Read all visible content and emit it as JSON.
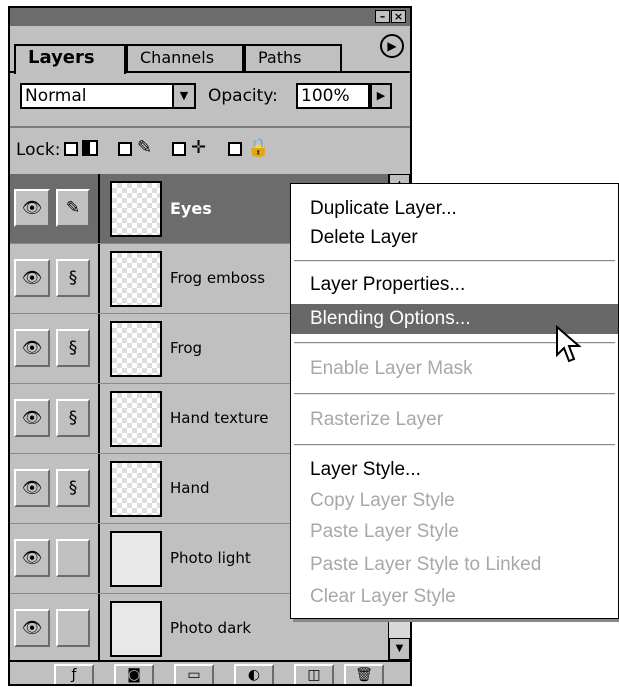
{
  "panel": {
    "window_buttons": {
      "minimize": "–",
      "close": "×"
    },
    "tabs": [
      {
        "label": "Layers"
      },
      {
        "label": "Channels"
      },
      {
        "label": "Paths"
      }
    ],
    "menu_arrow": "▶"
  },
  "blend": {
    "mode": "Normal",
    "opacity_label": "Opacity:",
    "opacity_value": "100%"
  },
  "lock": {
    "label": "Lock:",
    "icons": [
      "transparency-lock-icon",
      "brush-icon",
      "move-icon",
      "padlock-icon"
    ]
  },
  "layers": [
    {
      "name": "Eyes",
      "selected": true,
      "link_icon": "brush-icon"
    },
    {
      "name": "Frog emboss",
      "selected": false,
      "link_icon": "chain-link-icon"
    },
    {
      "name": "Frog",
      "selected": false,
      "link_icon": "chain-link-icon"
    },
    {
      "name": "Hand texture",
      "selected": false,
      "link_icon": "chain-link-icon"
    },
    {
      "name": "Hand",
      "selected": false,
      "link_icon": "chain-link-icon"
    },
    {
      "name": "Photo light",
      "selected": false,
      "link_icon": ""
    },
    {
      "name": "Photo dark",
      "selected": false,
      "link_icon": ""
    }
  ],
  "bottom_buttons": [
    "layer-style-icon",
    "layer-mask-icon",
    "new-folder-icon",
    "adjustment-layer-icon",
    "new-layer-icon",
    "trash-icon"
  ],
  "context_menu": {
    "items": [
      {
        "label": "Duplicate Layer...",
        "enabled": true
      },
      {
        "label": "Delete Layer",
        "enabled": true
      },
      {
        "label": "Layer Properties...",
        "enabled": true
      },
      {
        "label": "Blending Options...",
        "enabled": true,
        "highlighted": true
      },
      {
        "label": "Enable Layer Mask",
        "enabled": false
      },
      {
        "label": "Rasterize Layer",
        "enabled": false
      },
      {
        "label": "Layer Style...",
        "enabled": true
      },
      {
        "label": "Copy Layer Style",
        "enabled": false
      },
      {
        "label": "Paste Layer Style",
        "enabled": false
      },
      {
        "label": "Paste Layer Style to Linked",
        "enabled": false
      },
      {
        "label": "Clear Layer Style",
        "enabled": false
      }
    ]
  }
}
